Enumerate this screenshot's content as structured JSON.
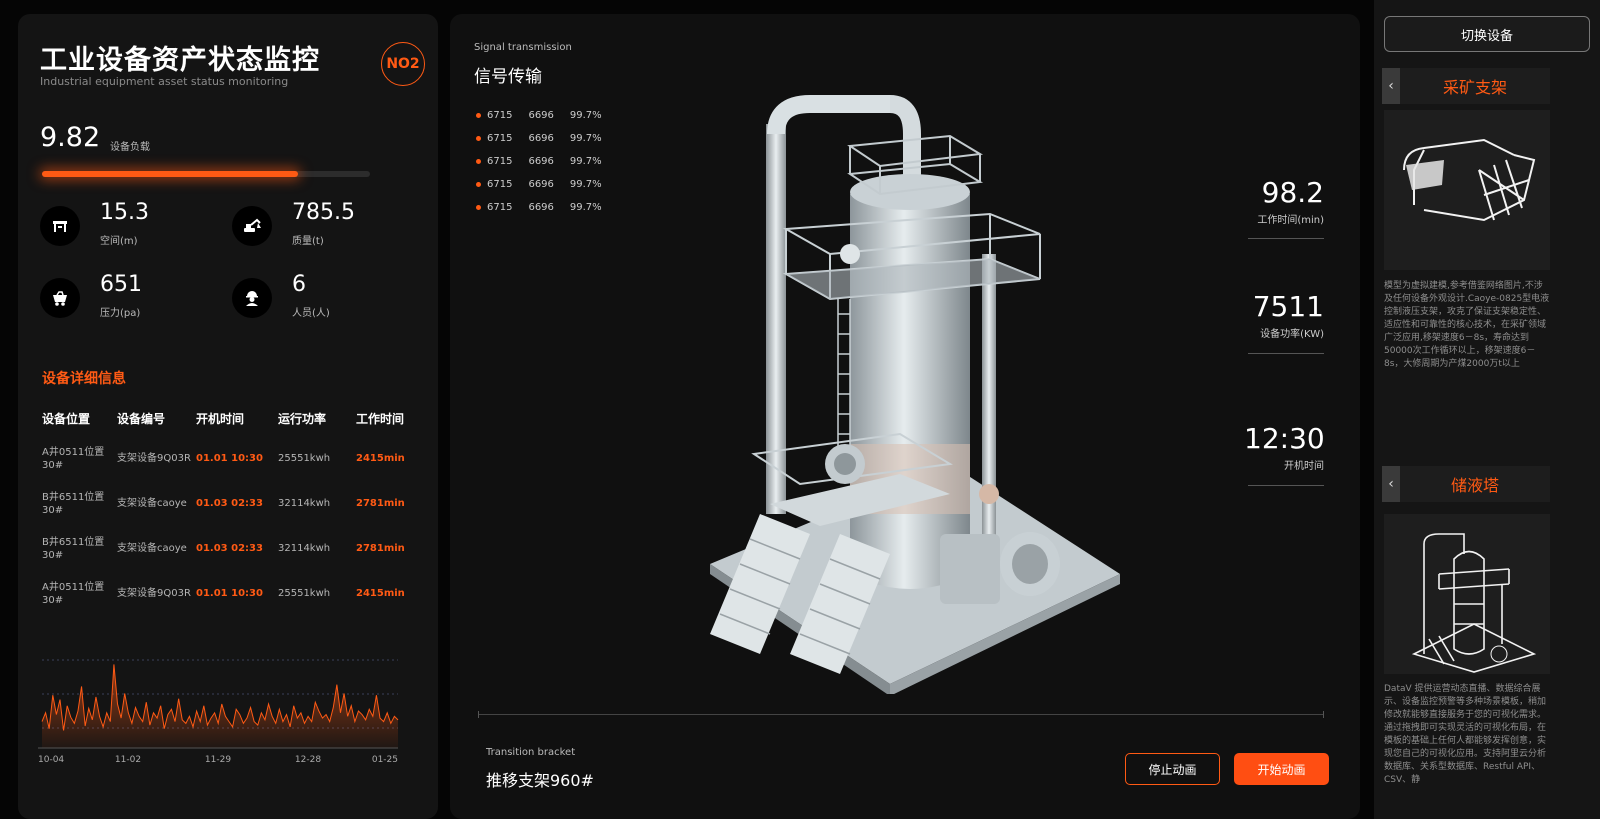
{
  "header": {
    "title": "工业设备资产状态监控",
    "subtitle": "Industrial equipment asset status monitoring",
    "badge": "NO2"
  },
  "load": {
    "value": "9.82",
    "label": "设备负载",
    "progress": 0.78
  },
  "stats": [
    {
      "value": "15.3",
      "label": "空间(m)",
      "icon": "ruler-icon"
    },
    {
      "value": "785.5",
      "label": "质量(t)",
      "icon": "excavator-icon"
    },
    {
      "value": "651",
      "label": "压力(pa)",
      "icon": "mining-cart-icon"
    },
    {
      "value": "6",
      "label": "人员(人)",
      "icon": "worker-icon"
    }
  ],
  "details": {
    "title": "设备详细信息",
    "columns": [
      "设备位置",
      "设备编号",
      "开机时间",
      "运行功率",
      "工作时间"
    ],
    "rows": [
      [
        "A井0511位置30#",
        "支架设备9Q03R",
        "01.01 10:30",
        "25551kwh",
        "2415min"
      ],
      [
        "B井6511位置30#",
        "支架设备caoye",
        "01.03 02:33",
        "32114kwh",
        "2781min"
      ],
      [
        "B井6511位置30#",
        "支架设备caoye",
        "01.03 02:33",
        "32114kwh",
        "2781min"
      ],
      [
        "A井0511位置30#",
        "支架设备9Q03R",
        "01.01 10:30",
        "25551kwh",
        "2415min"
      ]
    ]
  },
  "mini_chart": {
    "type": "area",
    "x_ticks": [
      "10-04",
      "11-02",
      "11-29",
      "12-28",
      "01-25"
    ],
    "values": [
      30,
      40,
      22,
      60,
      38,
      55,
      20,
      48,
      35,
      28,
      42,
      70,
      25,
      45,
      32,
      58,
      36,
      24,
      40,
      30,
      95,
      50,
      34,
      62,
      40,
      28,
      46,
      36,
      30,
      52,
      26,
      40,
      34,
      48,
      22,
      38,
      44,
      30,
      56,
      32,
      28,
      36,
      24,
      42,
      30,
      48,
      26,
      34,
      40,
      28,
      50,
      36,
      30,
      24,
      44,
      38,
      28,
      34,
      46,
      30,
      26,
      40,
      32,
      50,
      36,
      28,
      44,
      30,
      38,
      24,
      48,
      34,
      40,
      28,
      36,
      30,
      52,
      42,
      34,
      38,
      30,
      46,
      72,
      40,
      62,
      36,
      48,
      30,
      42,
      38,
      32,
      44,
      36,
      60,
      34,
      30,
      40,
      28,
      36,
      32
    ],
    "color": "#ff5a14"
  },
  "signal": {
    "subtitle": "Signal transmission",
    "title": "信号传输",
    "items": [
      [
        "6715",
        "6696",
        "99.7%"
      ],
      [
        "6715",
        "6696",
        "99.7%"
      ],
      [
        "6715",
        "6696",
        "99.7%"
      ],
      [
        "6715",
        "6696",
        "99.7%"
      ],
      [
        "6715",
        "6696",
        "99.7%"
      ]
    ]
  },
  "metrics": [
    {
      "value": "98.2",
      "label": "工作时间(min)"
    },
    {
      "value": "7511",
      "label": "设备功率(KW)"
    },
    {
      "value": "12:30",
      "label": "开机时间"
    }
  ],
  "transition": {
    "subtitle": "Transition bracket",
    "title": "推移支架960#",
    "stop_label": "停止动画",
    "start_label": "开始动画"
  },
  "right": {
    "switch_label": "切换设备",
    "devices": [
      {
        "name": "采矿支架",
        "desc": "模型为虚拟建模,参考借鉴网络图片,不涉及任何设备外观设计.Caoye-0825型电液控制液压支架，攻克了保证支架稳定性、适应性和可靠性的核心技术，在采矿领域广泛应用,移架速度6－8s，寿命达到50000次工作循环以上，移架速度6－8s，大修周期为产煤2000万t以上"
      },
      {
        "name": "储液塔",
        "desc": "DataV 提供运营动态直播、数据综合展示、设备监控预警等多种场景模板，稍加修改就能够直接服务于您的可视化需求。通过拖拽即可实现灵活的可视化布局，在模板的基础上任何人都能够发挥创意，实现您自己的可视化应用。支持阿里云分析数据库、关系型数据库、Restful API、CSV、静"
      }
    ]
  },
  "colors": {
    "accent": "#ff5a14",
    "panel": "#141414",
    "background": "#050505"
  }
}
